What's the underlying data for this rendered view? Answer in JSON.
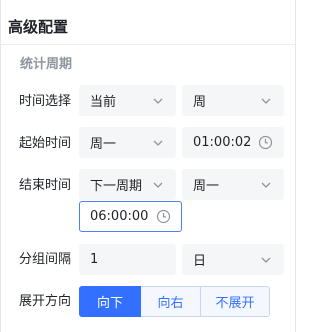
{
  "panel": {
    "title": "高级配置",
    "section_title": "统计周期"
  },
  "rows": {
    "time_select": {
      "label": "时间选择",
      "select_a": "当前",
      "select_b": "周"
    },
    "start_time": {
      "label": "起始时间",
      "weekday": "周一",
      "time": "01:00:02"
    },
    "end_time": {
      "label": "结束时间",
      "period": "下一周期",
      "weekday": "周一",
      "time": "06:00:00"
    },
    "group_interval": {
      "label": "分组间隔",
      "value": "1",
      "unit": "日"
    },
    "expand_direction": {
      "label": "展开方向",
      "options": [
        "向下",
        "向右",
        "不展开"
      ],
      "selected": "向下"
    }
  },
  "icons": {
    "dropdown": "chevron-down-icon",
    "time": "clock-icon"
  },
  "colors": {
    "accent": "#3370ff",
    "field_bg": "#f5f6f7",
    "muted_text": "#8f959e",
    "active_border": "#4e7ff5"
  }
}
